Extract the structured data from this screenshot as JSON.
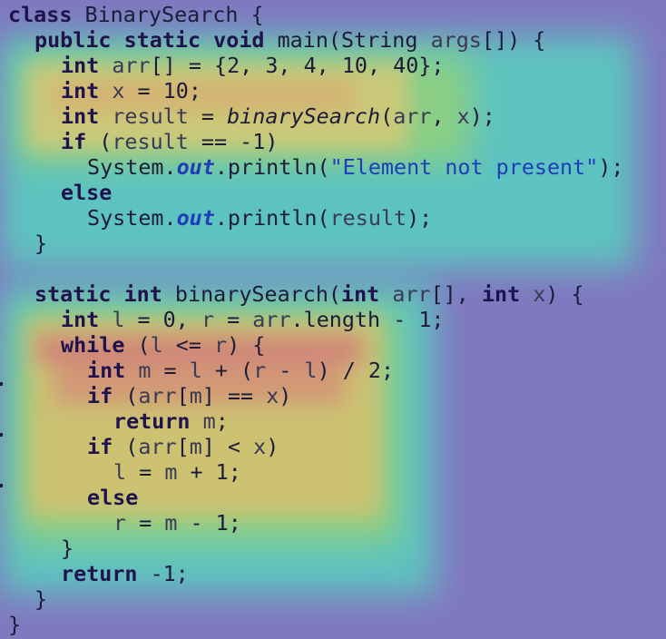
{
  "colors": {
    "background": "#8079c0",
    "keyword": "#20124d",
    "field": "#1f3db8",
    "string": "#1f3db8",
    "text": "#1c1c3a"
  },
  "code": {
    "lines": [
      {
        "indent": 0,
        "tokens": [
          [
            "kw",
            "class"
          ],
          [
            "t",
            " BinarySearch {"
          ]
        ]
      },
      {
        "indent": 1,
        "tokens": [
          [
            "kw",
            "public static void"
          ],
          [
            "t",
            " main(String "
          ],
          [
            "v",
            "args"
          ],
          [
            "t",
            "[]) {"
          ]
        ]
      },
      {
        "indent": 2,
        "tokens": [
          [
            "ty",
            "int"
          ],
          [
            "t",
            " "
          ],
          [
            "v",
            "arr"
          ],
          [
            "t",
            "[] = {2, 3, 4, 10, 40};"
          ]
        ]
      },
      {
        "indent": 2,
        "tokens": [
          [
            "ty",
            "int"
          ],
          [
            "t",
            " "
          ],
          [
            "v",
            "x"
          ],
          [
            "t",
            " = 10;"
          ]
        ]
      },
      {
        "indent": 2,
        "tokens": [
          [
            "ty",
            "int"
          ],
          [
            "t",
            " "
          ],
          [
            "v",
            "result"
          ],
          [
            "t",
            " = "
          ],
          [
            "it",
            "binarySearch"
          ],
          [
            "t",
            "("
          ],
          [
            "v",
            "arr"
          ],
          [
            "t",
            ", "
          ],
          [
            "v",
            "x"
          ],
          [
            "t",
            ");"
          ]
        ]
      },
      {
        "indent": 2,
        "tokens": [
          [
            "kw",
            "if"
          ],
          [
            "t",
            " ("
          ],
          [
            "v",
            "result"
          ],
          [
            "t",
            " == -1)"
          ]
        ]
      },
      {
        "indent": 3,
        "tokens": [
          [
            "t",
            "System."
          ],
          [
            "fld",
            "out"
          ],
          [
            "t",
            ".println("
          ],
          [
            "str",
            "\"Element not present\""
          ],
          [
            "t",
            ");"
          ]
        ]
      },
      {
        "indent": 2,
        "tokens": [
          [
            "kw",
            "else"
          ]
        ]
      },
      {
        "indent": 3,
        "tokens": [
          [
            "t",
            "System."
          ],
          [
            "fld",
            "out"
          ],
          [
            "t",
            ".println("
          ],
          [
            "v",
            "result"
          ],
          [
            "t",
            ");"
          ]
        ]
      },
      {
        "indent": 1,
        "tokens": [
          [
            "t",
            "}"
          ]
        ]
      },
      {
        "indent": 0,
        "tokens": []
      },
      {
        "indent": 1,
        "tokens": [
          [
            "kw",
            "static"
          ],
          [
            "t",
            " "
          ],
          [
            "ty",
            "int"
          ],
          [
            "t",
            " binarySearch("
          ],
          [
            "ty",
            "int"
          ],
          [
            "t",
            " "
          ],
          [
            "v",
            "arr"
          ],
          [
            "t",
            "[], "
          ],
          [
            "ty",
            "int"
          ],
          [
            "t",
            " "
          ],
          [
            "v",
            "x"
          ],
          [
            "t",
            ") {"
          ]
        ]
      },
      {
        "indent": 2,
        "tokens": [
          [
            "ty",
            "int"
          ],
          [
            "t",
            " "
          ],
          [
            "v",
            "l"
          ],
          [
            "t",
            " = 0, "
          ],
          [
            "v",
            "r"
          ],
          [
            "t",
            " = "
          ],
          [
            "v",
            "arr"
          ],
          [
            "t",
            ".length - 1;"
          ]
        ]
      },
      {
        "indent": 2,
        "tokens": [
          [
            "kw",
            "while"
          ],
          [
            "t",
            " ("
          ],
          [
            "v",
            "l"
          ],
          [
            "t",
            " <= "
          ],
          [
            "v",
            "r"
          ],
          [
            "t",
            ") {"
          ]
        ]
      },
      {
        "indent": 3,
        "tokens": [
          [
            "ty",
            "int"
          ],
          [
            "t",
            " "
          ],
          [
            "v",
            "m"
          ],
          [
            "t",
            " = "
          ],
          [
            "v",
            "l"
          ],
          [
            "t",
            " + ("
          ],
          [
            "v",
            "r"
          ],
          [
            "t",
            " - "
          ],
          [
            "v",
            "l"
          ],
          [
            "t",
            ") / 2;"
          ]
        ]
      },
      {
        "indent": 3,
        "tokens": [
          [
            "kw",
            "if"
          ],
          [
            "t",
            " ("
          ],
          [
            "v",
            "arr"
          ],
          [
            "t",
            "["
          ],
          [
            "v",
            "m"
          ],
          [
            "t",
            "] == "
          ],
          [
            "v",
            "x"
          ],
          [
            "t",
            ")"
          ]
        ]
      },
      {
        "indent": 4,
        "tokens": [
          [
            "kw",
            "return"
          ],
          [
            "t",
            " "
          ],
          [
            "v",
            "m"
          ],
          [
            "t",
            ";"
          ]
        ]
      },
      {
        "indent": 3,
        "tokens": [
          [
            "kw",
            "if"
          ],
          [
            "t",
            " ("
          ],
          [
            "v",
            "arr"
          ],
          [
            "t",
            "["
          ],
          [
            "v",
            "m"
          ],
          [
            "t",
            "] < "
          ],
          [
            "v",
            "x"
          ],
          [
            "t",
            ")"
          ]
        ]
      },
      {
        "indent": 4,
        "tokens": [
          [
            "v",
            "l"
          ],
          [
            "t",
            " = "
          ],
          [
            "v",
            "m"
          ],
          [
            "t",
            " + 1;"
          ]
        ]
      },
      {
        "indent": 3,
        "tokens": [
          [
            "kw",
            "else"
          ]
        ]
      },
      {
        "indent": 4,
        "tokens": [
          [
            "v",
            "r"
          ],
          [
            "t",
            " = "
          ],
          [
            "v",
            "m"
          ],
          [
            "t",
            " - 1;"
          ]
        ]
      },
      {
        "indent": 2,
        "tokens": [
          [
            "t",
            "}"
          ]
        ]
      },
      {
        "indent": 2,
        "tokens": [
          [
            "kw",
            "return"
          ],
          [
            "t",
            " -1;"
          ]
        ]
      },
      {
        "indent": 1,
        "tokens": [
          [
            "t",
            "}"
          ]
        ]
      },
      {
        "indent": 0,
        "tokens": [
          [
            "t",
            "}"
          ]
        ]
      }
    ]
  }
}
